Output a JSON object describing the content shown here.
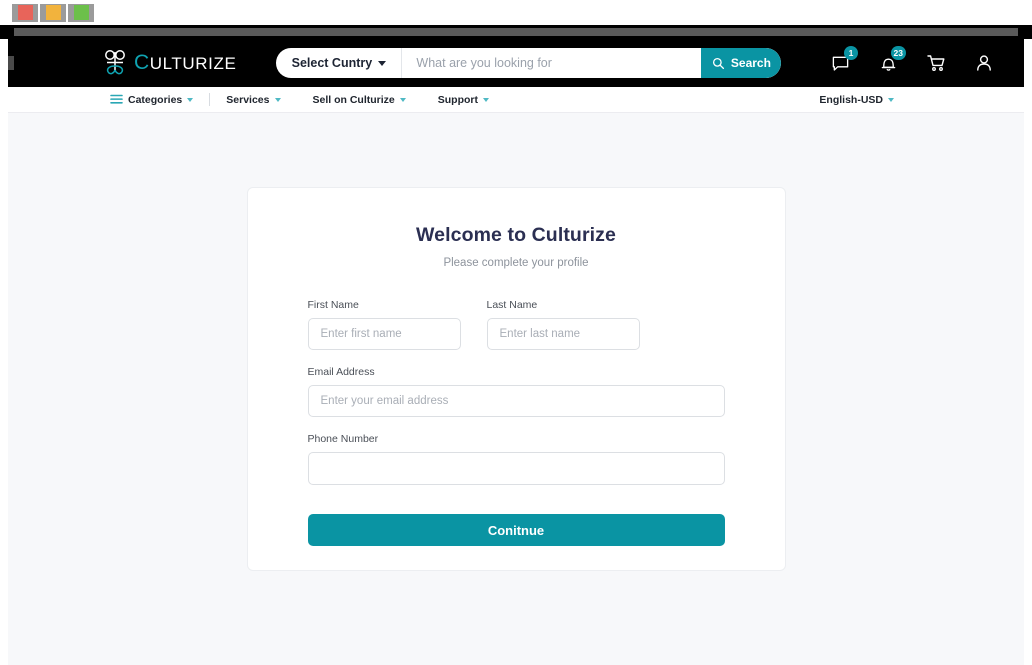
{
  "window": {
    "controls": [
      {
        "name": "close",
        "color": "#e8645a"
      },
      {
        "name": "minimize",
        "color": "#f2b33d"
      },
      {
        "name": "maximize",
        "color": "#6cc04a"
      }
    ]
  },
  "header": {
    "brand": {
      "logo_icon": "culturize-knot-icon",
      "initial": "C",
      "rest": "ULTURIZE",
      "accent_color": "#0fa3b1"
    },
    "search": {
      "country_label": "Select Cuntry",
      "country_caret_icon": "chevron-down-icon",
      "placeholder": "What are you looking for",
      "value": "",
      "button_label": "Search",
      "button_icon": "search-icon",
      "button_color": "#0a94a3"
    },
    "icons": [
      {
        "name": "chat-icon",
        "badge": "1"
      },
      {
        "name": "bell-icon",
        "badge": "23"
      },
      {
        "name": "cart-icon",
        "badge": ""
      },
      {
        "name": "user-icon",
        "badge": ""
      }
    ]
  },
  "nav": {
    "menu_icon": "list-icon",
    "items": [
      {
        "label": "Categories",
        "caret": "chevron-down-icon"
      },
      {
        "label": "Services",
        "caret": "chevron-down-icon"
      },
      {
        "label": "Sell on Culturize",
        "caret": "chevron-down-icon"
      },
      {
        "label": "Support",
        "caret": "chevron-down-icon"
      }
    ],
    "locale": {
      "label": "English-USD",
      "caret": "chevron-down-icon"
    }
  },
  "card": {
    "title": "Welcome to Culturize",
    "subtitle": "Please complete your profile",
    "fields": {
      "first_name": {
        "label": "First Name",
        "placeholder": "Enter first name",
        "value": ""
      },
      "last_name": {
        "label": "Last Name",
        "placeholder": "Enter last name",
        "value": ""
      },
      "email": {
        "label": "Email Address",
        "placeholder": "Enter your email address",
        "value": ""
      },
      "phone": {
        "label": "Phone Number",
        "placeholder": "",
        "value": ""
      }
    },
    "submit_label": "Conitnue",
    "submit_color": "#0a94a3"
  },
  "theme": {
    "accent": "#0a94a3",
    "header_bg": "#000000",
    "page_bg": "#f7f8fa",
    "title_color": "#2b2f52"
  }
}
